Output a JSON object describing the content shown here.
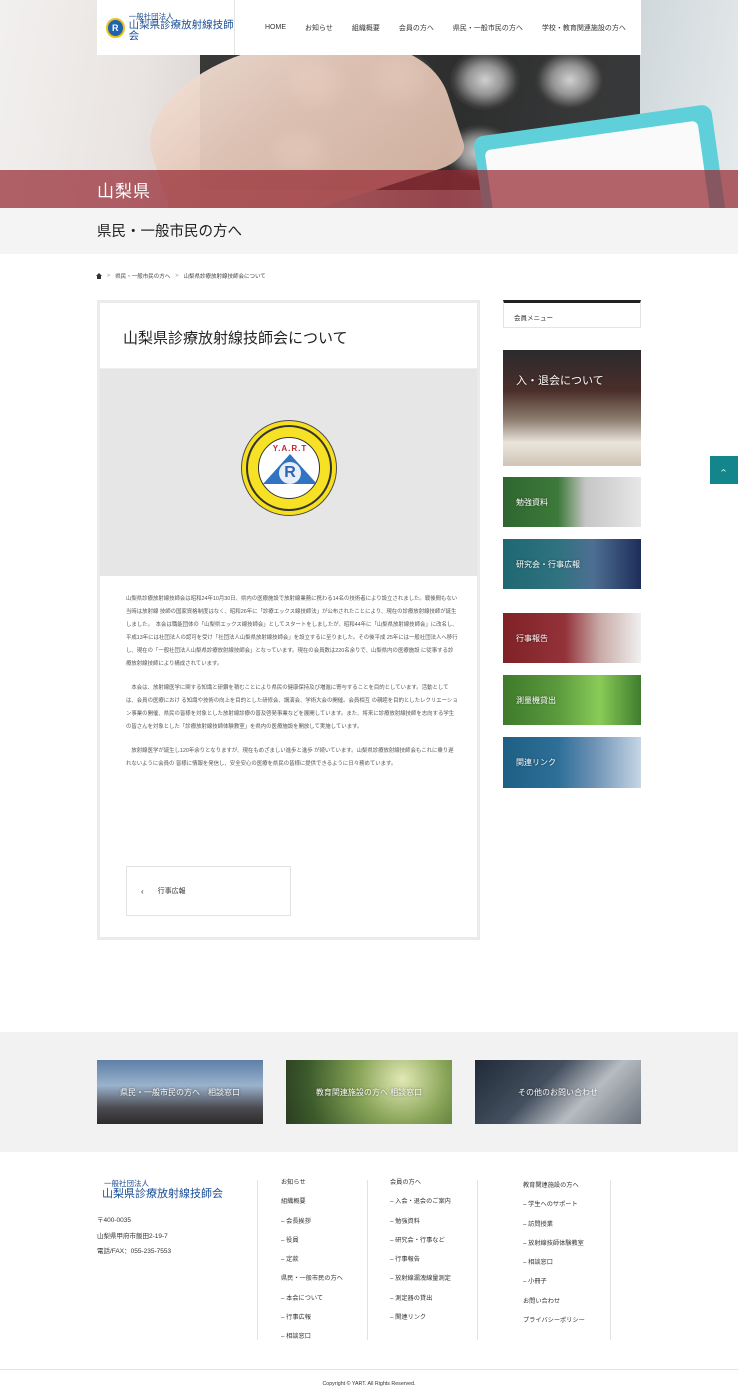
{
  "header": {
    "logo_sub": "一般社団法人",
    "logo_main": "山梨県診療放射線技師会",
    "logo_mark": "R",
    "nav": [
      "HOME",
      "お知らせ",
      "組織概要",
      "会員の方へ",
      "県民・一般市民の方へ",
      "学校・教育関連施設の方へ"
    ]
  },
  "hero": {
    "band_text": "山梨県"
  },
  "page_title": "県民・一般市民の方へ",
  "breadcrumb": {
    "sep": ">",
    "items": [
      "県民・一般市民の方へ",
      "山梨県診療放射線技師会について"
    ]
  },
  "article": {
    "title": "山梨県診療放射線技師会について",
    "emblem_text": "Y.A.R.T",
    "emblem_letter": "R",
    "paragraphs": [
      "山梨県診療放射線技師会は昭和24年10月30日、県内の医療施設で放射線業務に携わる14名の技術者により設立されました。戦後間もない当時は放射線 技師の国家資格制度はなく、昭和26年に「診療エックス線技師法」が公布されたことにより、現在の診療放射線技師が誕生しました。　本会は職能団体の「山梨県エックス線技師会」としてスタートをしましたが、昭和44年に「山梨県放射線技師会」に改名し、平成13年には社団法人の認可を受け「社団法人山梨県放射線技師会」を設立するに至りました。その後平成 25年には一般社団法人へ移行し、現在の「一般社団法人山梨県診療放射線技師会」となっています。現在の会員数は220名余りで、山梨県内の医療施設 に従事する診療放射線技師により構成されています。",
      "　本会は、放射線医学に関する知識と研鑽を積むことにより県民の健康保持及び増進に寄与することを目的としています。活動としては、会員の医療におけ る知識や技術の向上を目的とした研修会、講演会、学術大会の開催。会員相互 の親睦を目的としたレクリエーション事業の開催、県民の皆様を対象とした放射線診療の普及啓発事業などを展開しています。また、将来に診療放射線技師を志向する学生の皆さんを対象とした「診療放射線技師体験教室」を県内の医療施設を開放して実施しています。",
      "　放射線医学が誕生し120年余りとなりますが、現在もめざましい進歩と進歩 が続いています。山梨県診療放射線技師会もこれに乗り遅れないように会員の 皆様に情報を発信し、安全安心の医療を県民の皆様に提供できるように日々務めています。"
    ],
    "prev_label": "行事広報",
    "prev_chevron": "‹"
  },
  "sidebar": {
    "heading": "会員メニュー",
    "banners": [
      "入・退会について",
      "勉強資料",
      "研究会・行事広報",
      "行事報告",
      "測量機貸出",
      "関連リンク"
    ]
  },
  "page_top": "›",
  "contact": [
    "県民・一般市民の方へ　相談窓口",
    "教育関連施設の方へ 相談窓口",
    "その他のお問い合わせ"
  ],
  "footer": {
    "logo_sub": "一般社団法人",
    "logo_main": "山梨県診療放射線技師会",
    "address": [
      "〒400-0035",
      "山梨県甲府市飯田2-19-7",
      "電話/FAX：055-235-7553"
    ],
    "col1": [
      "お知らせ",
      "組織概要",
      "– 会長挨拶",
      "– 役員",
      "– 定款",
      "県民・一般市民の方へ",
      "– 本会について",
      "– 行事広報",
      "– 相談窓口"
    ],
    "col2": [
      "会員の方へ",
      "– 入会・退会のご案内",
      "– 勉強資料",
      "– 研究会・行事など",
      "– 行事報告",
      "– 放射線漏洩線量測定",
      "– 測定器の貸出",
      "– 関連リンク"
    ],
    "col3": [
      "教育関連施設の方へ",
      "– 学生へのサポート",
      "– 訪問授業",
      "– 放射線技師体験教室",
      "– 相談窓口",
      "– 小冊子",
      "お問い合わせ",
      "プライバシーポリシー"
    ],
    "copyright": "Copyright © YART. All Rights Reserved."
  }
}
